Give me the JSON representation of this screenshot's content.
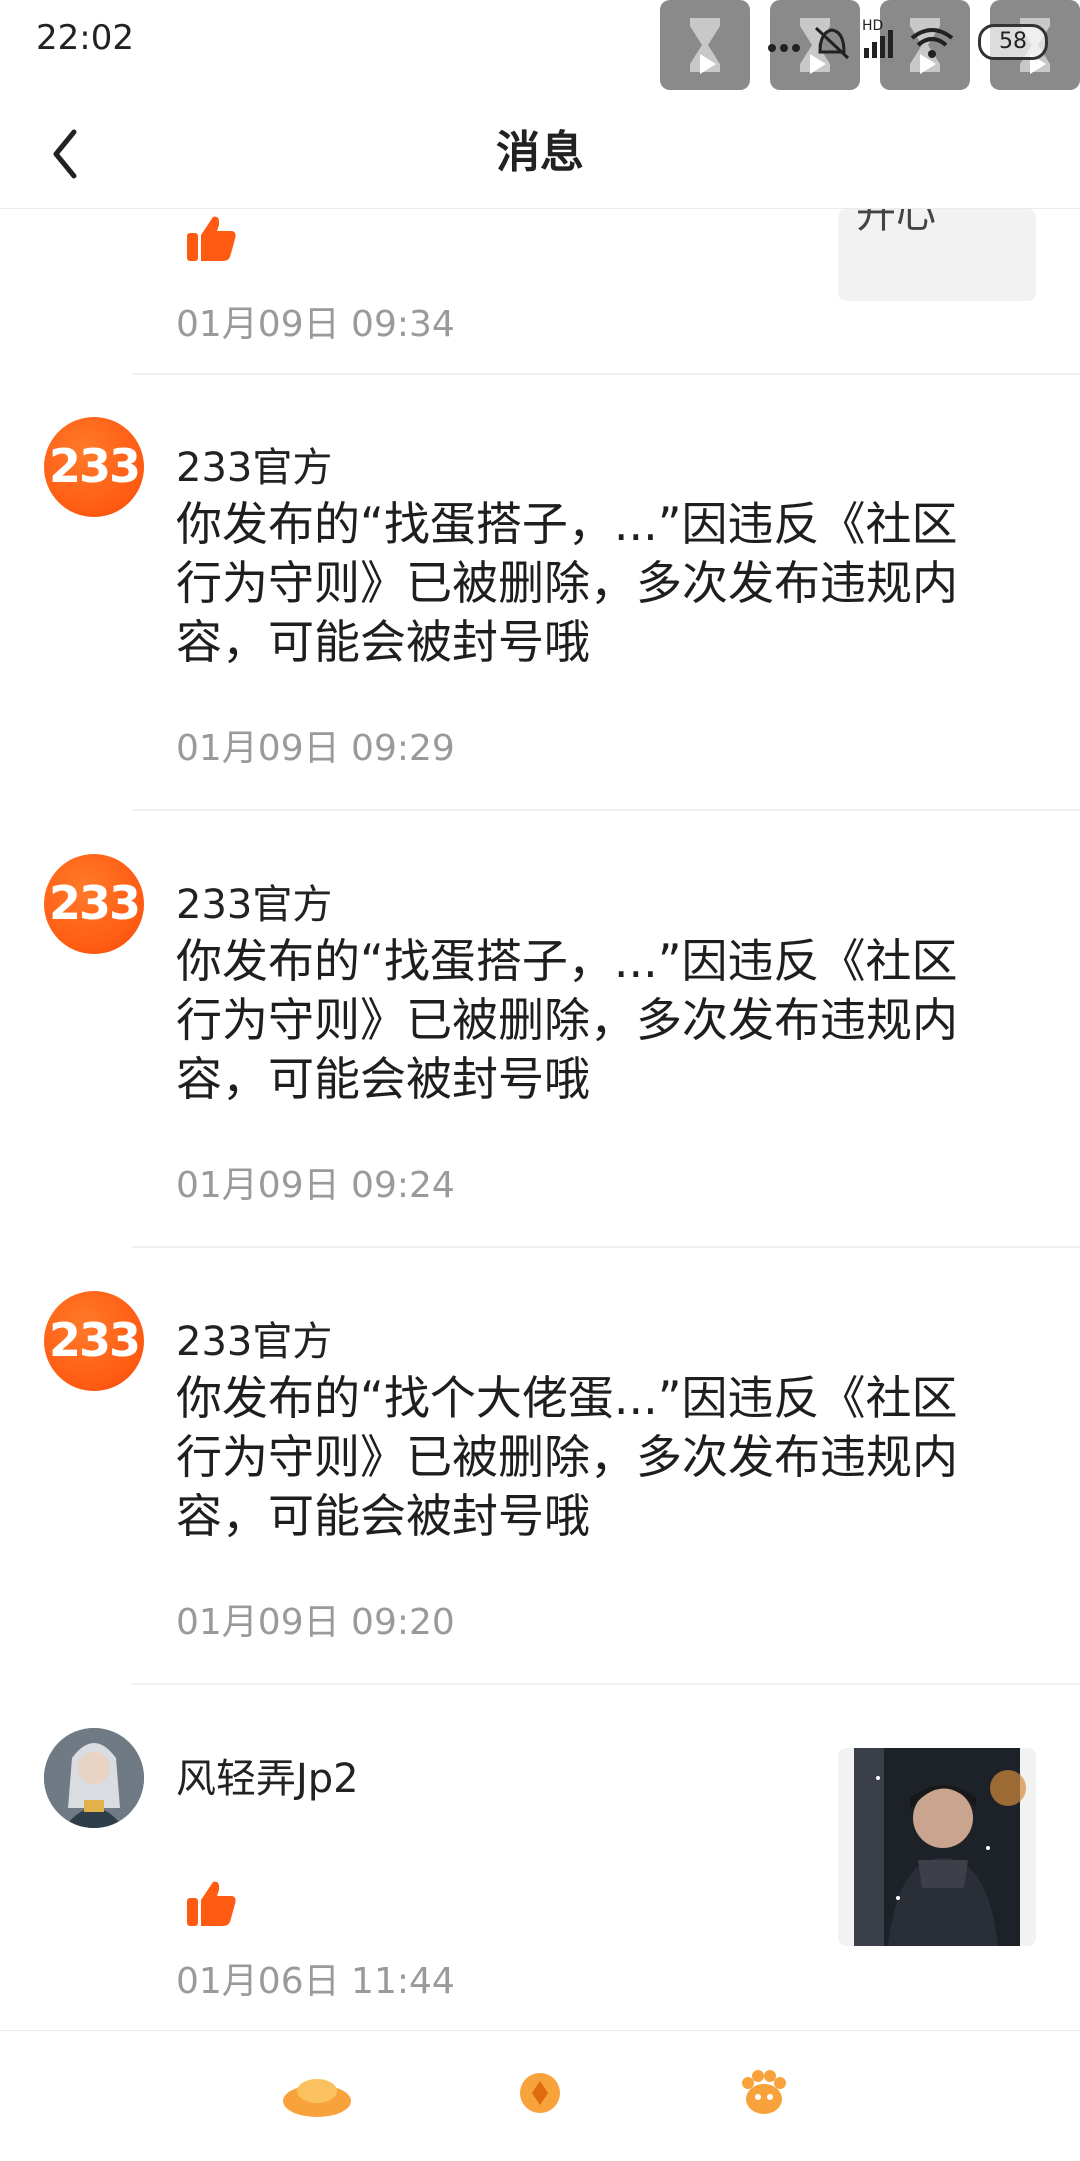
{
  "status_bar": {
    "time": "22:02",
    "battery": "58",
    "network_label": "HD"
  },
  "header": {
    "title": "消息"
  },
  "messages": [
    {
      "type": "like",
      "preview_text": "开心",
      "time": "01月09日 09:34"
    },
    {
      "type": "notice",
      "avatar_text": "233",
      "sender": "233官方",
      "text": "你发布的“找蛋搭子，...”因违反《社区行为守则》已被删除，多次发布违规内容，可能会被封号哦",
      "time": "01月09日 09:29"
    },
    {
      "type": "notice",
      "avatar_text": "233",
      "sender": "233官方",
      "text": "你发布的“找蛋搭子，...”因违反《社区行为守则》已被删除，多次发布违规内容，可能会被封号哦",
      "time": "01月09日 09:24"
    },
    {
      "type": "notice",
      "avatar_text": "233",
      "sender": "233官方",
      "text": "你发布的“找个大佬蛋...”因违反《社区行为守则》已被删除，多次发布违规内容，可能会被封号哦",
      "time": "01月09日 09:20"
    },
    {
      "type": "like",
      "sender": "风轻弄Jp2",
      "time": "01月06日 11:44"
    }
  ],
  "icons": {
    "back": "chevron-left-icon",
    "like": "thumbs-up-icon",
    "bottom": [
      "gold-ingot-icon",
      "coin-icon",
      "paw-icon"
    ]
  },
  "colors": {
    "accent": "#ff5a12",
    "like": "#ff5a12",
    "timestamp": "#9a9a9a",
    "bottom_icons": "#f7a23a"
  }
}
